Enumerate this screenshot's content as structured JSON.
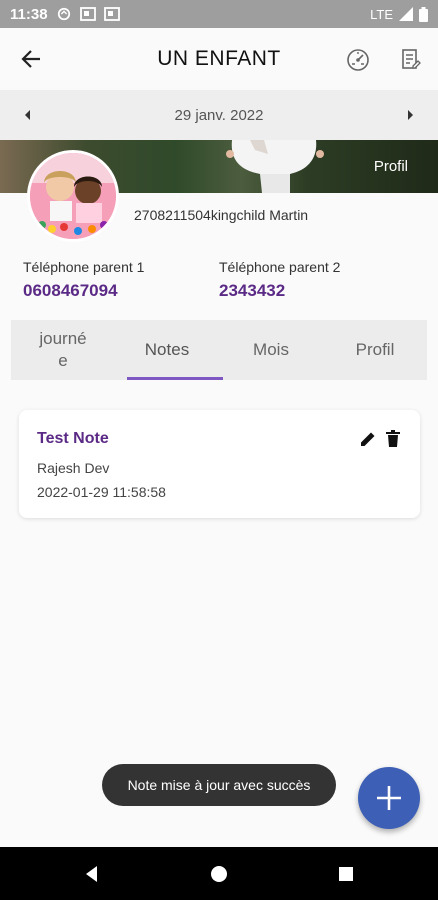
{
  "status_bar": {
    "time": "11:38",
    "network": "LTE"
  },
  "app_bar": {
    "title": "UN ENFANT",
    "icons": [
      "back-arrow-icon",
      "dashboard-icon",
      "report-icon"
    ]
  },
  "date_nav": {
    "date": "29 janv. 2022"
  },
  "banner": {
    "label": "Profil"
  },
  "child": {
    "name": "2708211504kingchild Martin"
  },
  "parents": [
    {
      "label": "Téléphone parent 1",
      "value": "0608467094"
    },
    {
      "label": "Téléphone parent 2",
      "value": "2343432"
    }
  ],
  "tabs": [
    {
      "label": "journé\ne",
      "active": false
    },
    {
      "label": "Notes",
      "active": true
    },
    {
      "label": "Mois",
      "active": false
    },
    {
      "label": "Profil",
      "active": false
    }
  ],
  "notes": [
    {
      "title": "Test Note",
      "author": "Rajesh Dev",
      "datetime": "2022-01-29 11:58:58"
    }
  ],
  "toast": {
    "message": "Note mise à jour avec succès"
  },
  "colors": {
    "accent": "#5b2a86",
    "fab": "#3d5fb6",
    "tab_indicator": "#7e57c2"
  }
}
